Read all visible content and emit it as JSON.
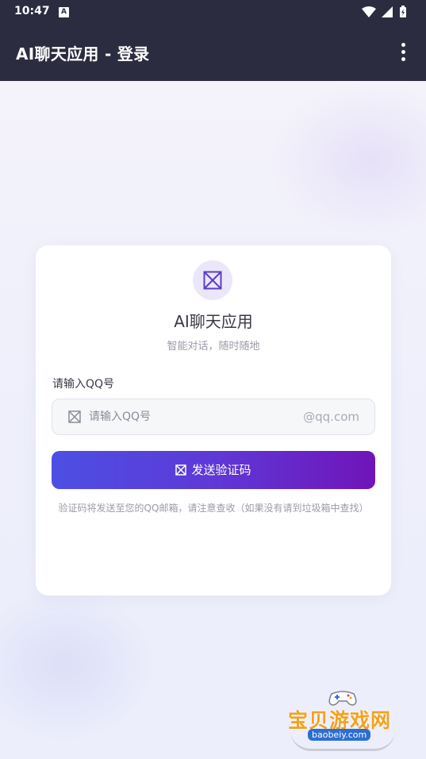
{
  "status_bar": {
    "time": "10:47",
    "notification_badge": "A",
    "icons": [
      "wifi-icon",
      "signal-icon",
      "battery-icon"
    ]
  },
  "app_bar": {
    "title": "AI聊天应用 - 登录",
    "menu_icon": "more-vert-icon"
  },
  "login_card": {
    "logo_icon": "placeholder-box-icon",
    "app_name": "AI聊天应用",
    "tagline": "智能对话，随时随地",
    "qq_field": {
      "label": "请输入QQ号",
      "placeholder": "请输入QQ号",
      "value": "",
      "suffix": "@qq.com",
      "icon": "placeholder-box-icon"
    },
    "send_button": {
      "label": "发送验证码",
      "icon": "placeholder-box-icon"
    },
    "hint": "验证码将发送至您的QQ邮箱，请注意查收（如果没有请到垃圾箱中查找）"
  },
  "watermark": {
    "text": "宝贝游戏网",
    "url": "baobeiy.com"
  },
  "colors": {
    "app_bar": "#2c2c40",
    "button_gradient_start": "#4c4fe3",
    "button_gradient_end": "#7014b9",
    "logo_accent": "#5b3fc8"
  }
}
